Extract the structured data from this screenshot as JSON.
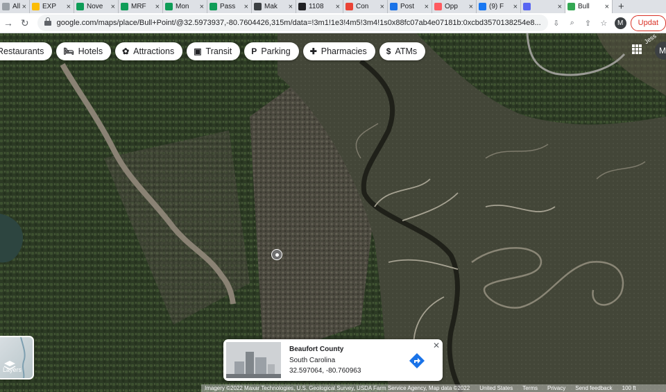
{
  "tabs": [
    {
      "label": "All y",
      "color": "#9aa0a6",
      "active": false
    },
    {
      "label": "EXP",
      "color": "#fbbc04",
      "active": false
    },
    {
      "label": "Nove",
      "color": "#0f9d58",
      "active": false
    },
    {
      "label": "MRF",
      "color": "#0f9d58",
      "active": false
    },
    {
      "label": "Mon",
      "color": "#0f9d58",
      "active": false
    },
    {
      "label": "Pass",
      "color": "#0f9d58",
      "active": false
    },
    {
      "label": "Mak",
      "color": "#3c4043",
      "active": false
    },
    {
      "label": "1108",
      "color": "#202124",
      "active": false
    },
    {
      "label": "Con",
      "color": "#ea4335",
      "active": false
    },
    {
      "label": "Post",
      "color": "#1a73e8",
      "active": false
    },
    {
      "label": "Opp",
      "color": "#ff5a5f",
      "active": false
    },
    {
      "label": "(9) F",
      "color": "#1877f2",
      "active": false
    },
    {
      "label": "",
      "color": "#5865f2",
      "active": false
    },
    {
      "label": "Bull",
      "color": "#34a853",
      "active": true
    }
  ],
  "browser": {
    "url": "google.com/maps/place/Bull+Point/@32.5973937,-80.7604426,315m/data=!3m1!1e3!4m5!3m4!1s0x88fc07ab4e07181b:0xcbd3570138254e8...",
    "update_label": "Updat",
    "avatar_letter": "M"
  },
  "chips": [
    {
      "label": "Restaurants",
      "icon": "restaurant-icon",
      "glyph": ""
    },
    {
      "label": "Hotels",
      "icon": "hotel-icon",
      "glyph": "🛏"
    },
    {
      "label": "Attractions",
      "icon": "attraction-icon",
      "glyph": "✿"
    },
    {
      "label": "Transit",
      "icon": "transit-icon",
      "glyph": "▣"
    },
    {
      "label": "Parking",
      "icon": "parking-icon",
      "glyph": "P"
    },
    {
      "label": "Pharmacies",
      "icon": "pharmacy-icon",
      "glyph": "✚"
    },
    {
      "label": "ATMs",
      "icon": "atm-icon",
      "glyph": "$"
    }
  ],
  "map": {
    "profile_letter": "M",
    "road_label": "Jess",
    "layers_label": "Layers"
  },
  "card": {
    "title": "Beaufort County",
    "subtitle": "South Carolina",
    "coords": "32.597064, -80.760963"
  },
  "footer": {
    "attribution": "Imagery ©2022 Maxar Technologies, U.S. Geological Survey, USDA Farm Service Agency, Map data ©2022",
    "country": "United States",
    "terms": "Terms",
    "privacy": "Privacy",
    "feedback": "Send feedback",
    "scale": "100 ft"
  },
  "colors": {
    "forest": "#2f3d26",
    "marsh": "#46483d",
    "channel": "#2a2a22",
    "road": "#8a8274"
  }
}
